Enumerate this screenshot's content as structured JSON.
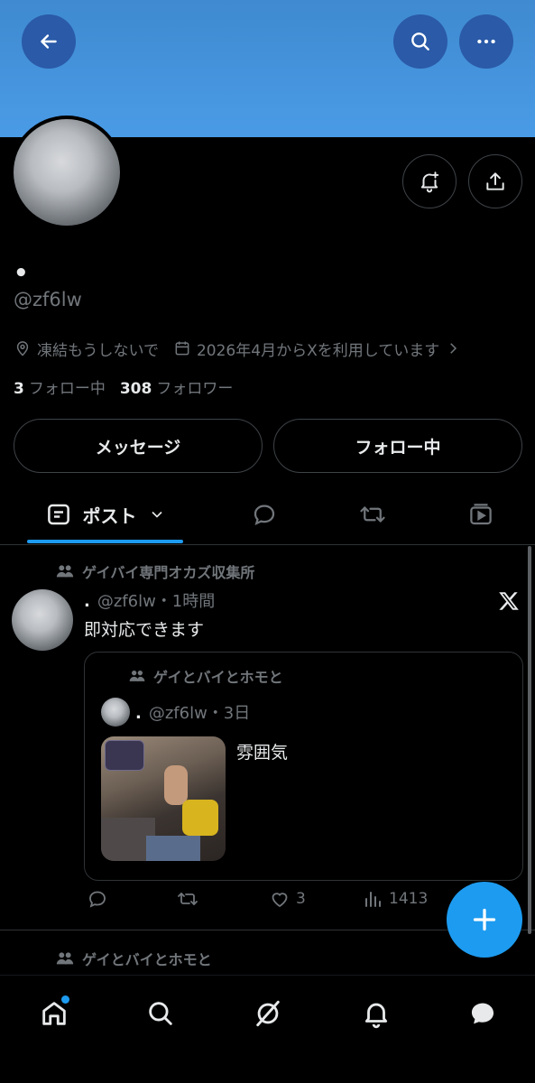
{
  "profile": {
    "display_name": "•",
    "handle": "@zf6lw",
    "location": "凍結もうしないで",
    "joined": "2026年4月からXを利用しています",
    "following_count": "3",
    "following_label": "フォロー中",
    "followers_count": "308",
    "followers_label": "フォロワー"
  },
  "buttons": {
    "message": "メッセージ",
    "following": "フォロー中"
  },
  "tabs": {
    "posts_label": "ポスト"
  },
  "post": {
    "context": "ゲイバイ専門オカズ収集所",
    "author": ".",
    "handle_time": "@zf6lw・1時間",
    "text": "即対応できます",
    "quote": {
      "context": "ゲイとバイとホモと",
      "author": ".",
      "handle_time": "@zf6lw・3日",
      "text": "雰囲気"
    },
    "likes": "3",
    "views": "1413"
  },
  "next_post": {
    "context": "ゲイとバイとホモと"
  },
  "colors": {
    "accent": "#1d9bf0",
    "banner": "#4a9be6",
    "muted": "#71767b"
  },
  "icons": [
    "back-arrow-icon",
    "search-icon",
    "more-icon",
    "bell-plus-icon",
    "share-icon",
    "location-icon",
    "calendar-icon",
    "community-icon",
    "x-logo-icon",
    "reply-icon",
    "retweet-icon",
    "like-icon",
    "views-icon",
    "plus-icon",
    "home-icon",
    "grok-icon",
    "notifications-icon",
    "messages-icon"
  ]
}
